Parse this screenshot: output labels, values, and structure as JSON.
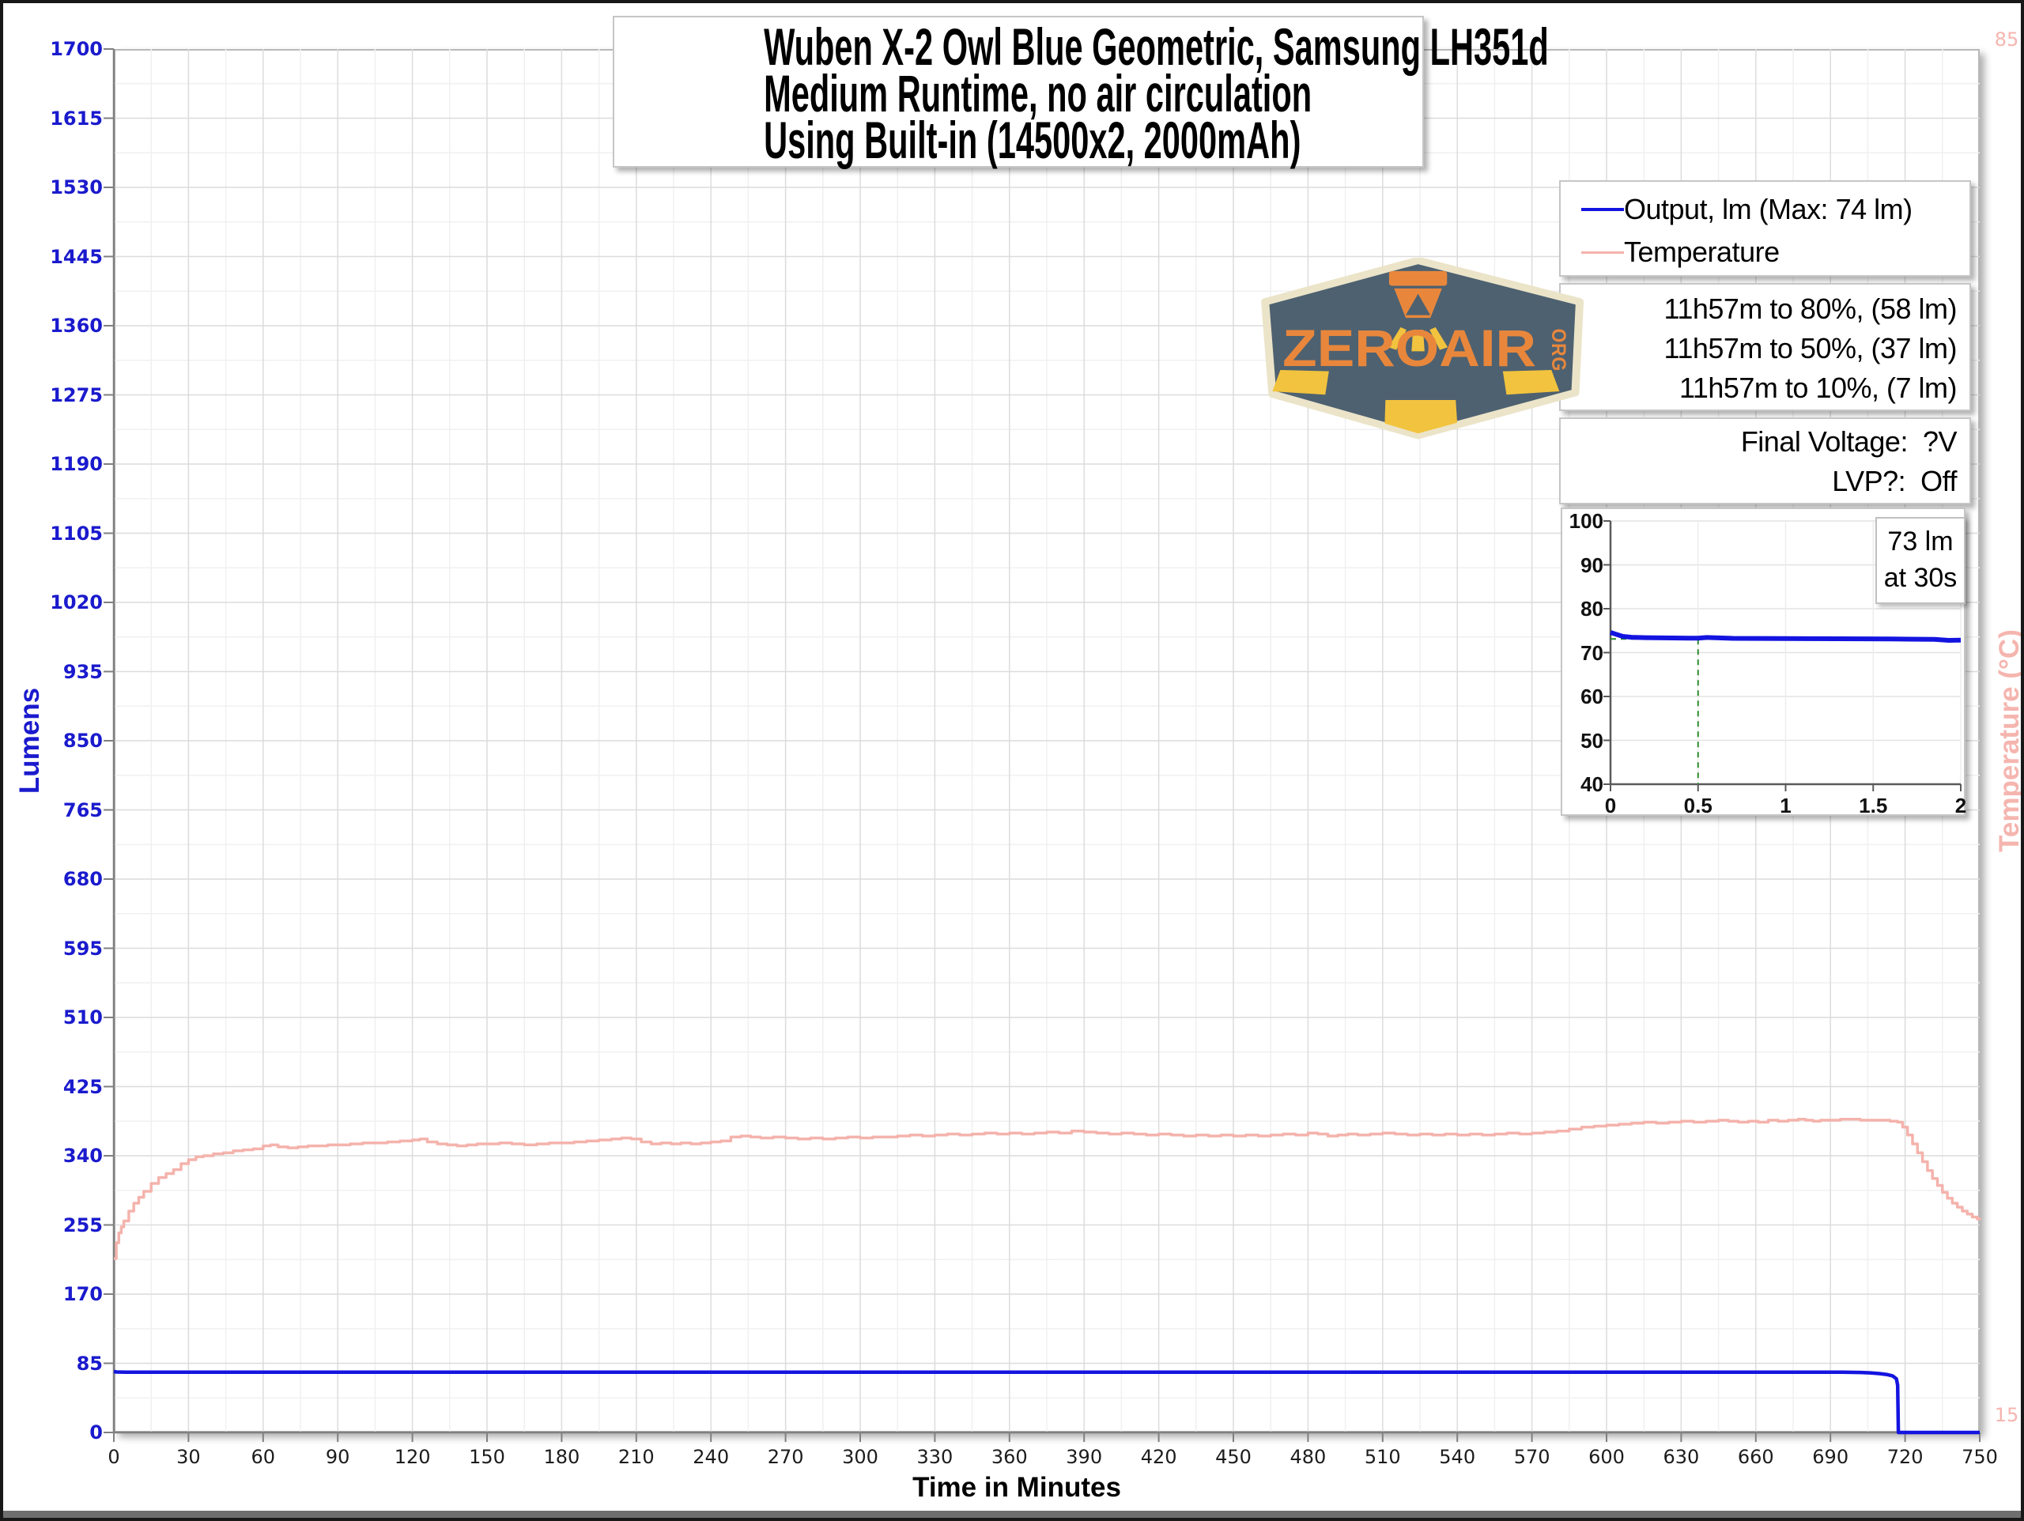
{
  "title": {
    "lines": [
      "Wuben X-2 Owl Blue Geometric, Samsung LH351d",
      "Medium Runtime, no air circulation",
      "Using Built-in (14500x2, 2000mAh)"
    ]
  },
  "legend": {
    "items": [
      {
        "label": "Output, lm (Max: 74 lm)",
        "color": "#1414e0",
        "thickness": 4
      },
      {
        "label": "Temperature",
        "color": "#f4b3ac",
        "thickness": 3
      }
    ]
  },
  "runtime_box": {
    "lines": [
      "11h57m to 80%, (58 lm)",
      "11h57m to 50%, (37 lm)",
      "11h57m to 10%, (7 lm)"
    ]
  },
  "voltage_box": {
    "lines": [
      "Final Voltage:  ?V",
      "LVP?:  Off"
    ]
  },
  "logo": {
    "text": "ZEROAIR",
    "suffix": "ORG",
    "badge_fill": "#4e6170",
    "badge_border": "#ebe4c9",
    "orange": "#e8873c",
    "yellow": "#f2c33e"
  },
  "colors": {
    "output_line": "#1414e0",
    "temperature_line": "#f4b3ac",
    "left_axis_text": "#1a1acd",
    "right_axis_text": "#f5b5af",
    "grid_major": "#dcdcdc",
    "grid_minor": "#f0f0f0",
    "axis_line": "#808080",
    "guide_green": "#2e8b2e"
  },
  "chart_data": [
    {
      "type": "line",
      "title": "",
      "xlabel": "Time in Minutes",
      "ylabel": "Lumens",
      "ylabel_right": "Temperature (°C)",
      "xlim": [
        0,
        750
      ],
      "ylim_left": [
        0,
        1700
      ],
      "ylim_right": [
        15,
        85
      ],
      "x_ticks": [
        0,
        30,
        60,
        90,
        120,
        150,
        180,
        210,
        240,
        270,
        300,
        330,
        360,
        390,
        420,
        450,
        480,
        510,
        540,
        570,
        600,
        630,
        660,
        690,
        720,
        750
      ],
      "x_minor_step": 15,
      "y_ticks_left": [
        0,
        85,
        170,
        255,
        340,
        425,
        510,
        595,
        680,
        765,
        850,
        935,
        1020,
        1105,
        1190,
        1275,
        1360,
        1445,
        1530,
        1615,
        1700
      ],
      "y_minor_step": 42.5,
      "y_right_visible_labels": [
        {
          "label": "85",
          "pos": "top"
        },
        {
          "label": "15",
          "pos": "bottom"
        }
      ],
      "grid": true,
      "legend_position": "outside-top-right",
      "series": [
        {
          "name": "Output, lm (Max: 74 lm)",
          "axis": "left",
          "unit": "lm",
          "color": "#1414e0",
          "width": 4.5,
          "interp": "linear",
          "points": [
            [
              0,
              75
            ],
            [
              1,
              74.3
            ],
            [
              5,
              74
            ],
            [
              60,
              74
            ],
            [
              120,
              74
            ],
            [
              180,
              74
            ],
            [
              240,
              74
            ],
            [
              300,
              74
            ],
            [
              360,
              74
            ],
            [
              420,
              74
            ],
            [
              480,
              74
            ],
            [
              540,
              74
            ],
            [
              600,
              74
            ],
            [
              660,
              74
            ],
            [
              695,
              74
            ],
            [
              702,
              73.7
            ],
            [
              706,
              73.2
            ],
            [
              710,
              72.3
            ],
            [
              713,
              71
            ],
            [
              715,
              69.5
            ],
            [
              716.5,
              66
            ],
            [
              717,
              58
            ],
            [
              717.3,
              0
            ],
            [
              725,
              0
            ],
            [
              750,
              0
            ]
          ]
        },
        {
          "name": "Temperature",
          "axis": "right",
          "unit": "°C",
          "color": "#f4b3ac",
          "width": 3.5,
          "interp": "step",
          "points": [
            [
              0,
              23.8
            ],
            [
              1,
              24.6
            ],
            [
              2,
              25.1
            ],
            [
              3,
              25.4
            ],
            [
              4,
              25.7
            ],
            [
              6,
              26.2
            ],
            [
              8,
              26.6
            ],
            [
              10,
              26.9
            ],
            [
              12,
              27.2
            ],
            [
              15,
              27.6
            ],
            [
              18,
              27.9
            ],
            [
              21,
              28.1
            ],
            [
              24,
              28.3
            ],
            [
              27,
              28.6
            ],
            [
              30,
              28.8
            ],
            [
              33,
              28.95
            ],
            [
              36,
              29.0
            ],
            [
              40,
              29.1
            ],
            [
              44,
              29.15
            ],
            [
              48,
              29.25
            ],
            [
              52,
              29.3
            ],
            [
              56,
              29.35
            ],
            [
              60,
              29.5
            ],
            [
              63,
              29.55
            ],
            [
              66,
              29.45
            ],
            [
              70,
              29.4
            ],
            [
              74,
              29.45
            ],
            [
              78,
              29.5
            ],
            [
              82,
              29.5
            ],
            [
              86,
              29.55
            ],
            [
              90,
              29.55
            ],
            [
              95,
              29.6
            ],
            [
              100,
              29.65
            ],
            [
              105,
              29.65
            ],
            [
              110,
              29.7
            ],
            [
              115,
              29.75
            ],
            [
              120,
              29.8
            ],
            [
              123,
              29.85
            ],
            [
              126,
              29.7
            ],
            [
              130,
              29.6
            ],
            [
              134,
              29.55
            ],
            [
              138,
              29.5
            ],
            [
              142,
              29.55
            ],
            [
              146,
              29.6
            ],
            [
              150,
              29.6
            ],
            [
              155,
              29.65
            ],
            [
              160,
              29.6
            ],
            [
              165,
              29.55
            ],
            [
              170,
              29.6
            ],
            [
              175,
              29.65
            ],
            [
              180,
              29.65
            ],
            [
              185,
              29.7
            ],
            [
              190,
              29.75
            ],
            [
              195,
              29.8
            ],
            [
              200,
              29.85
            ],
            [
              204,
              29.9
            ],
            [
              208,
              29.85
            ],
            [
              212,
              29.7
            ],
            [
              216,
              29.6
            ],
            [
              220,
              29.65
            ],
            [
              224,
              29.6
            ],
            [
              228,
              29.65
            ],
            [
              232,
              29.6
            ],
            [
              236,
              29.65
            ],
            [
              240,
              29.7
            ],
            [
              244,
              29.75
            ],
            [
              248,
              29.95
            ],
            [
              252,
              30.0
            ],
            [
              256,
              29.95
            ],
            [
              260,
              29.9
            ],
            [
              265,
              29.95
            ],
            [
              270,
              29.9
            ],
            [
              275,
              29.85
            ],
            [
              280,
              29.9
            ],
            [
              285,
              29.85
            ],
            [
              290,
              29.9
            ],
            [
              295,
              29.95
            ],
            [
              300,
              29.9
            ],
            [
              305,
              29.95
            ],
            [
              310,
              29.95
            ],
            [
              315,
              30.0
            ],
            [
              320,
              30.05
            ],
            [
              325,
              30.0
            ],
            [
              330,
              30.05
            ],
            [
              335,
              30.1
            ],
            [
              340,
              30.05
            ],
            [
              345,
              30.1
            ],
            [
              350,
              30.15
            ],
            [
              355,
              30.1
            ],
            [
              360,
              30.15
            ],
            [
              365,
              30.1
            ],
            [
              370,
              30.15
            ],
            [
              375,
              30.2
            ],
            [
              380,
              30.15
            ],
            [
              385,
              30.25
            ],
            [
              390,
              30.2
            ],
            [
              395,
              30.15
            ],
            [
              400,
              30.1
            ],
            [
              405,
              30.15
            ],
            [
              410,
              30.1
            ],
            [
              415,
              30.05
            ],
            [
              420,
              30.1
            ],
            [
              425,
              30.05
            ],
            [
              430,
              30.0
            ],
            [
              435,
              30.05
            ],
            [
              440,
              30.0
            ],
            [
              445,
              30.05
            ],
            [
              450,
              30.0
            ],
            [
              455,
              30.05
            ],
            [
              460,
              30.0
            ],
            [
              465,
              30.05
            ],
            [
              470,
              30.1
            ],
            [
              475,
              30.05
            ],
            [
              480,
              30.15
            ],
            [
              484,
              30.1
            ],
            [
              488,
              30.0
            ],
            [
              492,
              30.05
            ],
            [
              496,
              30.1
            ],
            [
              500,
              30.05
            ],
            [
              505,
              30.1
            ],
            [
              510,
              30.15
            ],
            [
              515,
              30.1
            ],
            [
              520,
              30.05
            ],
            [
              525,
              30.1
            ],
            [
              530,
              30.05
            ],
            [
              535,
              30.1
            ],
            [
              540,
              30.05
            ],
            [
              545,
              30.1
            ],
            [
              550,
              30.05
            ],
            [
              555,
              30.1
            ],
            [
              560,
              30.15
            ],
            [
              565,
              30.1
            ],
            [
              570,
              30.15
            ],
            [
              575,
              30.2
            ],
            [
              580,
              30.25
            ],
            [
              585,
              30.35
            ],
            [
              590,
              30.45
            ],
            [
              595,
              30.5
            ],
            [
              600,
              30.55
            ],
            [
              605,
              30.6
            ],
            [
              610,
              30.65
            ],
            [
              615,
              30.7
            ],
            [
              620,
              30.65
            ],
            [
              625,
              30.7
            ],
            [
              630,
              30.75
            ],
            [
              635,
              30.7
            ],
            [
              640,
              30.75
            ],
            [
              645,
              30.8
            ],
            [
              649,
              30.75
            ],
            [
              653,
              30.7
            ],
            [
              657,
              30.75
            ],
            [
              661,
              30.7
            ],
            [
              665,
              30.8
            ],
            [
              669,
              30.75
            ],
            [
              673,
              30.8
            ],
            [
              677,
              30.85
            ],
            [
              680,
              30.8
            ],
            [
              683,
              30.75
            ],
            [
              686,
              30.8
            ],
            [
              690,
              30.8
            ],
            [
              694,
              30.85
            ],
            [
              698,
              30.85
            ],
            [
              702,
              30.8
            ],
            [
              706,
              30.8
            ],
            [
              710,
              30.8
            ],
            [
              714,
              30.75
            ],
            [
              717,
              30.7
            ],
            [
              719,
              30.45
            ],
            [
              721,
              30.05
            ],
            [
              723,
              29.6
            ],
            [
              725,
              29.15
            ],
            [
              727,
              28.7
            ],
            [
              729,
              28.25
            ],
            [
              731,
              27.85
            ],
            [
              733,
              27.5
            ],
            [
              735,
              27.15
            ],
            [
              737,
              26.85
            ],
            [
              739,
              26.6
            ],
            [
              741,
              26.4
            ],
            [
              743,
              26.2
            ],
            [
              745,
              26.05
            ],
            [
              747,
              25.9
            ],
            [
              749,
              25.8
            ],
            [
              750,
              25.75
            ]
          ]
        }
      ]
    },
    {
      "type": "line",
      "title": "",
      "xlabel": "",
      "ylabel": "",
      "xlim": [
        0,
        2
      ],
      "ylim": [
        40,
        100
      ],
      "x_ticks": [
        {
          "v": 0,
          "label": "0"
        },
        {
          "v": 0.5,
          "label": "0.5"
        },
        {
          "v": 1,
          "label": "1"
        },
        {
          "v": 1.5,
          "label": "1.5"
        },
        {
          "v": 2,
          "label": "2"
        }
      ],
      "y_ticks": [
        40,
        50,
        60,
        70,
        80,
        90,
        100
      ],
      "grid": true,
      "series": [
        {
          "name": "Output, lm",
          "color": "#1414e0",
          "width": 6,
          "interp": "linear",
          "points": [
            [
              0,
              74.6
            ],
            [
              0.03,
              74.2
            ],
            [
              0.07,
              73.7
            ],
            [
              0.12,
              73.5
            ],
            [
              0.2,
              73.4
            ],
            [
              0.3,
              73.35
            ],
            [
              0.45,
              73.3
            ],
            [
              0.5,
              73.3
            ],
            [
              0.55,
              73.45
            ],
            [
              0.7,
              73.25
            ],
            [
              1.0,
              73.2
            ],
            [
              1.3,
              73.15
            ],
            [
              1.6,
              73.1
            ],
            [
              1.85,
              73.0
            ],
            [
              1.93,
              72.8
            ],
            [
              2,
              72.85
            ]
          ]
        }
      ],
      "guides": {
        "color": "#2e8b2e",
        "x": 0.5,
        "y": 73.1
      },
      "annotation": {
        "lines": [
          "73 lm",
          "at 30s"
        ]
      }
    }
  ]
}
